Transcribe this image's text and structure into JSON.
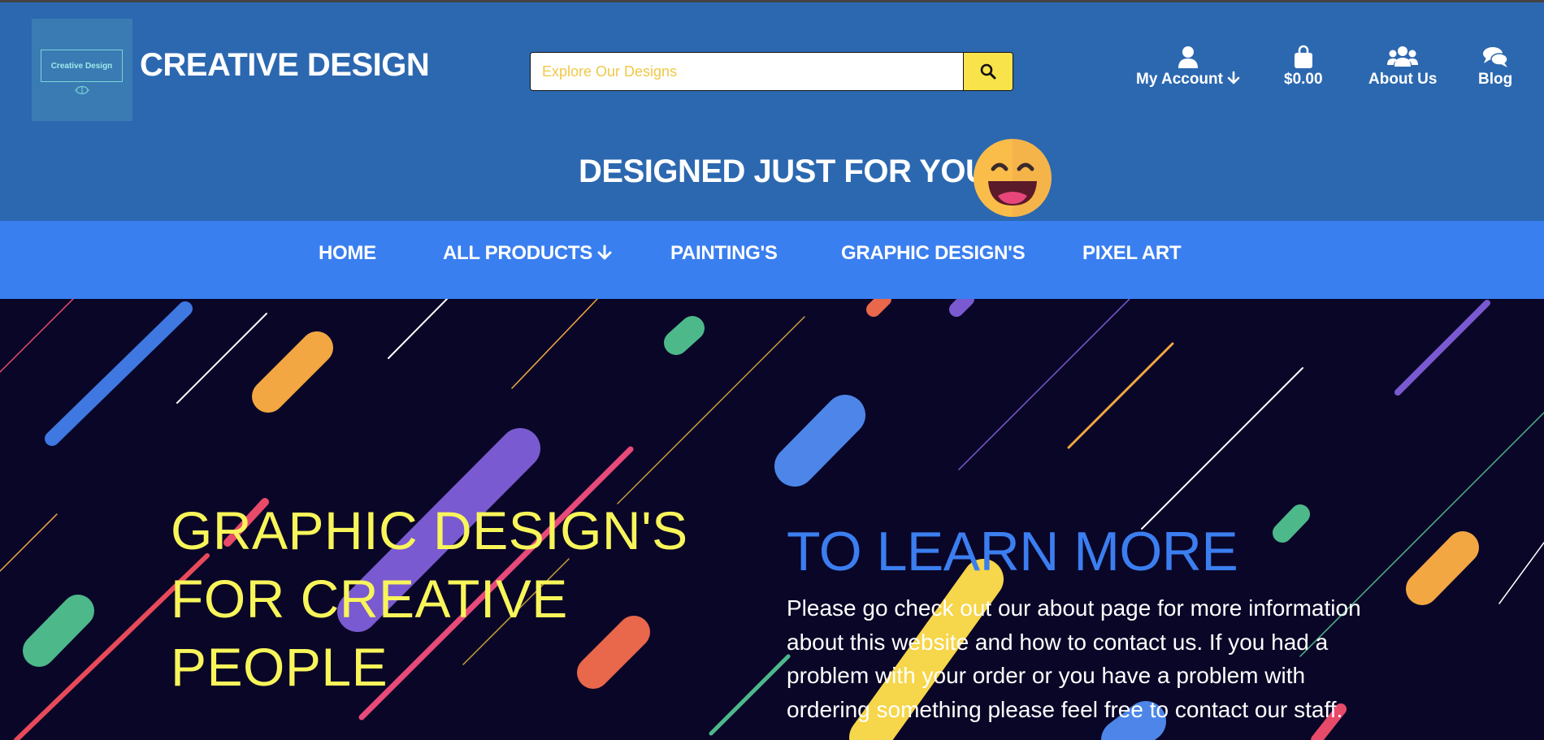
{
  "header": {
    "logo_text": "Creative Design",
    "brand": "CREATIVE DESIGN",
    "search_placeholder": "Explore Our Designs",
    "links": {
      "account": "My Account",
      "cart": "$0.00",
      "about": "About Us",
      "blog": "Blog"
    },
    "tagline": "DESIGNED JUST FOR YOU"
  },
  "nav": {
    "home": "HOME",
    "all_products": "ALL PRODUCTS",
    "paintings": "PAINTING'S",
    "graphic_designs": "GRAPHIC DESIGN'S",
    "pixel_art": "PIXEL ART"
  },
  "hero": {
    "title_line1": "GRAPHIC DESIGN'S",
    "title_line2": "FOR CREATIVE",
    "title_line3": "PEOPLE",
    "learn_title": "TO LEARN MORE",
    "learn_text": "Please go check out our about page for more information about this website and how to contact us. If you had a problem with your order or you have a problem with ordering something please feel free to contact our staff."
  },
  "colors": {
    "header_bg": "#2c68b0",
    "nav_bg": "#3a7ff0",
    "hero_bg": "#0a0628",
    "accent_yellow": "#f8f55a",
    "accent_blue": "#3b7ef0"
  },
  "icons": {
    "search": "search-icon",
    "account": "user-icon",
    "cart": "shopping-bag-icon",
    "about": "users-icon",
    "blog": "comments-icon",
    "arrow": "arrow-down-icon",
    "emoji": "grinning-face-icon"
  }
}
